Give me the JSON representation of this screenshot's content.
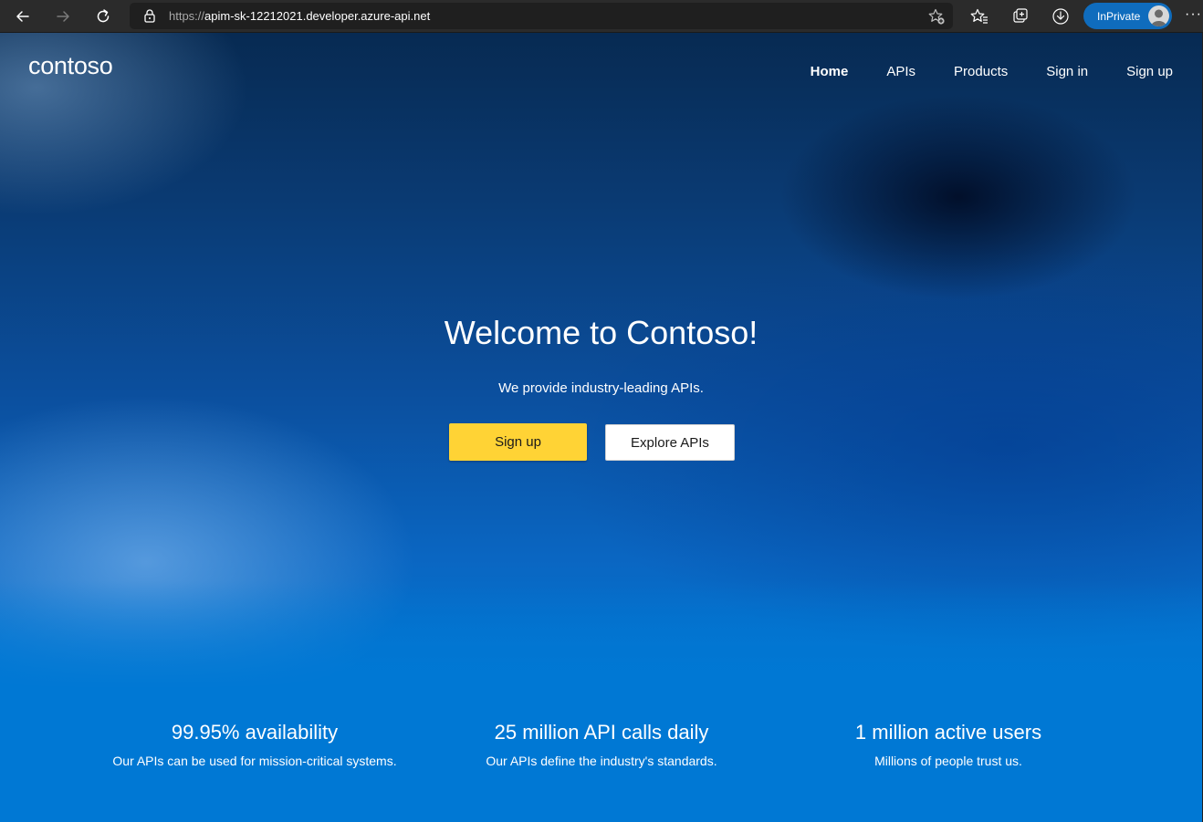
{
  "browser": {
    "url_scheme": "https://",
    "url_host": "apim-sk-12212021.developer.azure-api.net",
    "inprivate_label": "InPrivate",
    "icons": [
      "back-icon",
      "forward-icon",
      "refresh-icon",
      "lock-icon",
      "add-favorite-icon",
      "favorites-icon",
      "collections-icon",
      "downloads-icon",
      "profile-icon",
      "more-icon"
    ]
  },
  "site": {
    "logo": "contoso",
    "nav": [
      {
        "label": "Home",
        "active": true
      },
      {
        "label": "APIs"
      },
      {
        "label": "Products"
      },
      {
        "label": "Sign in"
      },
      {
        "label": "Sign up"
      }
    ]
  },
  "hero": {
    "title": "Welcome to Contoso!",
    "subtitle": "We provide industry-leading APIs.",
    "primary_button": "Sign up",
    "secondary_button": "Explore APIs"
  },
  "stats": [
    {
      "title": "99.95% availability",
      "desc": "Our APIs can be used for mission-critical systems."
    },
    {
      "title": "25 million API calls daily",
      "desc": "Our APIs define the industry's standards."
    },
    {
      "title": "1 million active users",
      "desc": "Millions of people trust us."
    }
  ],
  "colors": {
    "primary_button": "#ffd335",
    "page_blue": "#0078d4",
    "inprivate_badge": "#0f6cbd"
  }
}
